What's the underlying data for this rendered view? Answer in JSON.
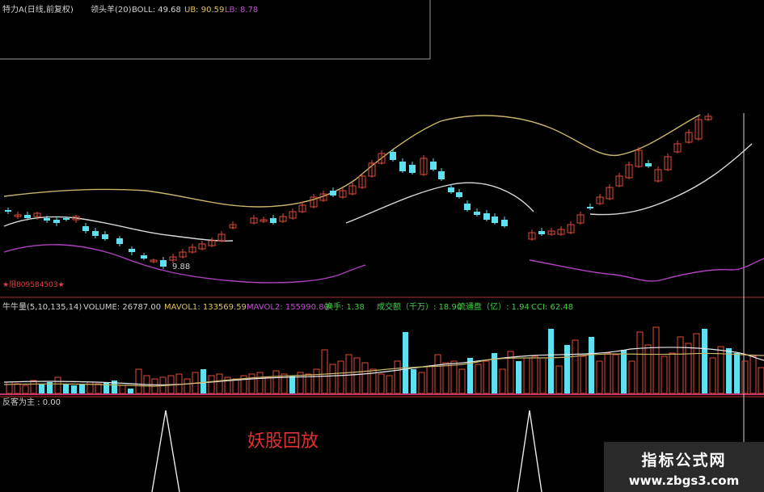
{
  "header": {
    "title": "特力A(日线,前复权)",
    "indicator_name": "领头羊(20)",
    "boll_label": "BOLL: 49.68",
    "ub_label": "UB: 90.59",
    "lb_label": "LB: 8.78",
    "min_price_label": "9.88",
    "chip_text": "★阻809584503★"
  },
  "volume_panel": {
    "title": "牛牛量(5,10,135,14)",
    "volume": "VOLUME: 26787.00",
    "mavol1": "MAVOL1: 133569.59",
    "mavol2": "MAVOL2: 155990.80",
    "turnover": "换手: 1.38",
    "amount": "成交额（千万）: 18.90",
    "float_cap": "流通盘（亿）: 1.94",
    "cci": "CCI: 62.48"
  },
  "signal_panel": {
    "title": "反客为主 : 0.00",
    "annotation": "妖股回放"
  },
  "watermark": {
    "title": "指标公式网",
    "url": "www.zbgs3.com"
  },
  "colors": {
    "background": "#000000",
    "up": "#e04a3a",
    "down": "#5fe0f0",
    "upper_band": "#c8b46a",
    "mid_band": "#d8d8d8",
    "lower_band": "#b040c0",
    "magenta_axis": "#c0306a"
  }
}
